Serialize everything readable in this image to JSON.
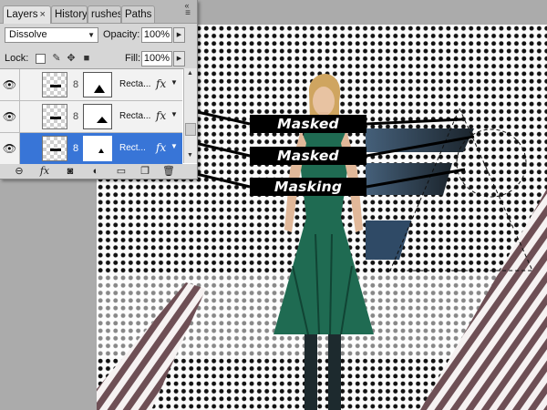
{
  "panel": {
    "tabs": [
      {
        "label": "Layers",
        "close": "×"
      },
      {
        "label": "History"
      },
      {
        "label": "rushes"
      },
      {
        "label": "Paths"
      }
    ],
    "blend_mode": "Dissolve",
    "opacity_label": "Opacity:",
    "opacity_value": "100%",
    "lock_label": "Lock:",
    "fill_label": "Fill:",
    "fill_value": "100%",
    "layers": [
      {
        "name": "Recta...",
        "fx": "fx",
        "selected": false,
        "visible": true
      },
      {
        "name": "Recta...",
        "fx": "fx",
        "selected": false,
        "visible": true
      },
      {
        "name": "Rect...",
        "fx": "fx",
        "selected": true,
        "visible": true
      }
    ],
    "icons": {
      "eye": "eye-icon",
      "chain": "link-icon",
      "menu": "panel-menu-icon",
      "bottom": [
        "link-layers-icon",
        "add-style-icon",
        "add-mask-icon",
        "adjustment-layer-icon",
        "new-group-icon",
        "new-layer-icon",
        "delete-layer-icon"
      ]
    }
  },
  "callouts": [
    "Masked",
    "Masked",
    "Masking"
  ],
  "colors": {
    "selection": "#3875d7",
    "dress": "#1f6b52",
    "stripe": "#6e4f55",
    "band": "#2c3b46"
  }
}
